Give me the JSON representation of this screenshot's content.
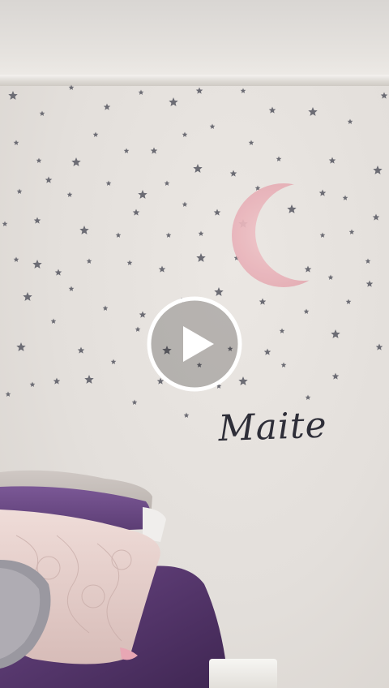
{
  "scene": {
    "wall_decal_name": "Maite",
    "play_button_icon": "play-icon",
    "colors": {
      "wall": "#e5e1dd",
      "stars": "#6c6c74",
      "moon": "#e8b4bb",
      "bedding": "#5b3a72",
      "pillows": "#e7cfcb",
      "text": "#2e2e38"
    }
  }
}
